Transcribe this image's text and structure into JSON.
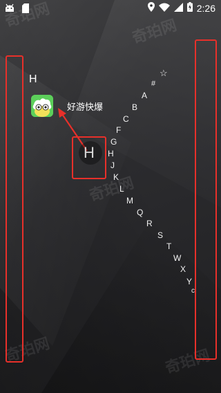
{
  "status_bar": {
    "time": "2:26",
    "left_icons": [
      "android-debug-icon",
      "sd-card-icon"
    ],
    "right_icons": [
      "location-icon",
      "wifi-icon",
      "signal-icon",
      "battery-charging-icon"
    ]
  },
  "section_header": "H",
  "app": {
    "name": "好游快爆",
    "icon": "haoyou-kuaibao-app-icon"
  },
  "scroller": {
    "current_letter": "H",
    "items": [
      "☆",
      "#",
      "A",
      "B",
      "C",
      "F",
      "G",
      "H",
      "J",
      "K",
      "L",
      "M",
      "Q",
      "R",
      "S",
      "T",
      "W",
      "X",
      "Y",
      "c"
    ]
  },
  "watermark_text": "奇珀网",
  "colors": {
    "highlight": "#e8302a",
    "annotation_arrow": "#e8302a",
    "app_icon_bg": "#5ccf5a"
  }
}
